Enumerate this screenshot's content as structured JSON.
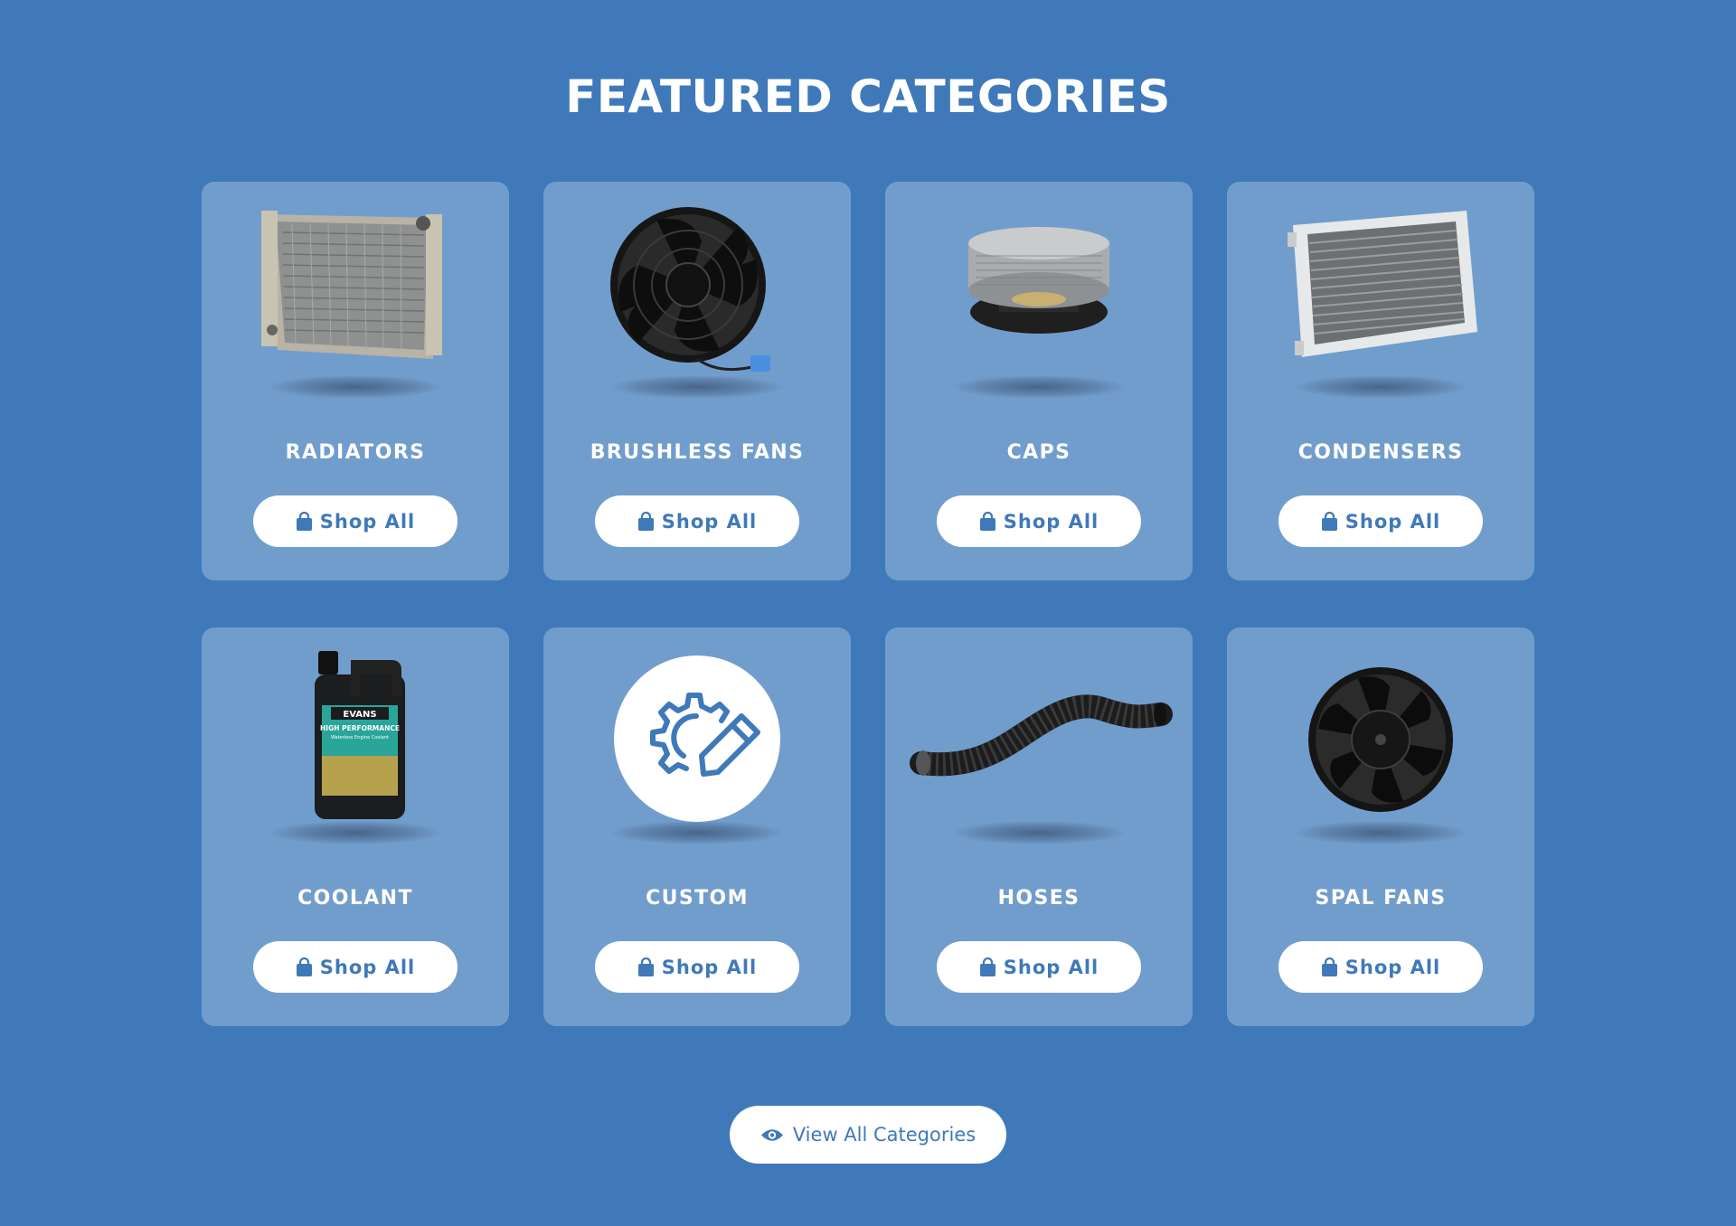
{
  "section": {
    "title": "FEATURED CATEGORIES"
  },
  "colors": {
    "background": "#3f79b9",
    "card": "#719dcc",
    "button": "#ffffff",
    "button_text": "#3f79b9"
  },
  "categories": [
    {
      "name": "RADIATORS",
      "button_label": "Shop All",
      "image": "radiator-image"
    },
    {
      "name": "BRUSHLESS FANS",
      "button_label": "Shop All",
      "image": "brushless-fan-image"
    },
    {
      "name": "CAPS",
      "button_label": "Shop All",
      "image": "cap-image"
    },
    {
      "name": "CONDENSERS",
      "button_label": "Shop All",
      "image": "condenser-image"
    },
    {
      "name": "COOLANT",
      "button_label": "Shop All",
      "image": "coolant-jug-image",
      "image_text": {
        "brand": "EVANS",
        "product": "HIGH PERFORMANCE",
        "tagline": "Waterless Engine Coolant"
      }
    },
    {
      "name": "CUSTOM",
      "button_label": "Shop All",
      "image": "gear-pencil-icon"
    },
    {
      "name": "HOSES",
      "button_label": "Shop All",
      "image": "hose-image"
    },
    {
      "name": "SPAL FANS",
      "button_label": "Shop All",
      "image": "spal-fan-image"
    }
  ],
  "icons": {
    "shop_button": "shopping-bag-icon",
    "view_all": "eye-icon"
  },
  "view_all_label": "View All Categories"
}
